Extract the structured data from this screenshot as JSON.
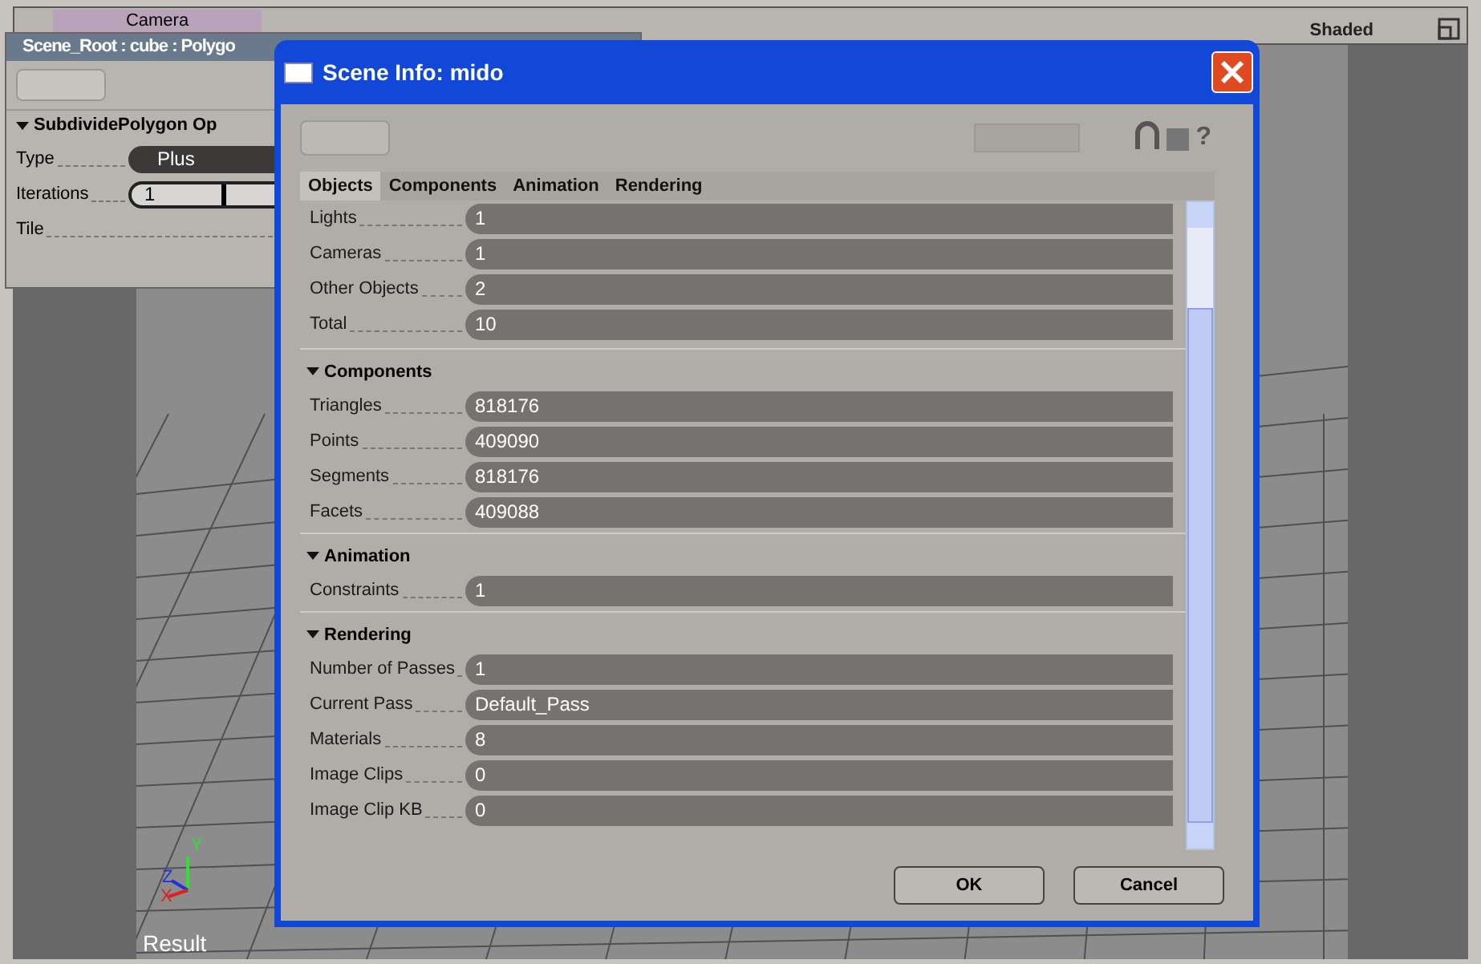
{
  "viewport_header": {
    "camera": "Camera",
    "display_mode": "Shaded"
  },
  "viewport": {
    "label": "Result",
    "axes": [
      "X",
      "Y",
      "Z"
    ]
  },
  "property_panel": {
    "title": "Scene_Root : cube : Polygo",
    "section": {
      "title": "SubdividePolygon Op",
      "expanded": true
    },
    "rows": [
      {
        "label": "Type",
        "kind": "dropdown",
        "value": "Plus"
      },
      {
        "label": "Iterations",
        "kind": "slider",
        "value": "1",
        "level": 0
      },
      {
        "label": "Tile",
        "kind": "label"
      }
    ]
  },
  "dialog": {
    "title": "Scene Info: mido",
    "tabs": [
      {
        "label": "Objects",
        "selected": true
      },
      {
        "label": "Components",
        "selected": false
      },
      {
        "label": "Animation",
        "selected": false
      },
      {
        "label": "Rendering",
        "selected": false
      }
    ],
    "groups": [
      {
        "rows": [
          {
            "label": "Lights",
            "value": "1"
          },
          {
            "label": "Cameras",
            "value": "1"
          },
          {
            "label": "Other Objects",
            "value": "2"
          },
          {
            "label": "Total",
            "value": "10"
          }
        ]
      },
      {
        "title": "Components",
        "expanded": true,
        "rows": [
          {
            "label": "Triangles",
            "value": "818176"
          },
          {
            "label": "Points",
            "value": "409090"
          },
          {
            "label": "Segments",
            "value": "818176"
          },
          {
            "label": "Facets",
            "value": "409088"
          }
        ]
      },
      {
        "title": "Animation",
        "expanded": true,
        "rows": [
          {
            "label": "Constraints",
            "value": "1"
          }
        ]
      },
      {
        "title": "Rendering",
        "expanded": true,
        "rows": [
          {
            "label": "Number of Passes",
            "value": "1"
          },
          {
            "label": "Current Pass",
            "value": "Default_Pass"
          },
          {
            "label": "Materials",
            "value": "8"
          },
          {
            "label": "Image Clips",
            "value": "0"
          },
          {
            "label": "Image Clip KB",
            "value": "0"
          }
        ]
      }
    ],
    "help_button": "?",
    "buttons": [
      "OK",
      "Cancel"
    ]
  }
}
